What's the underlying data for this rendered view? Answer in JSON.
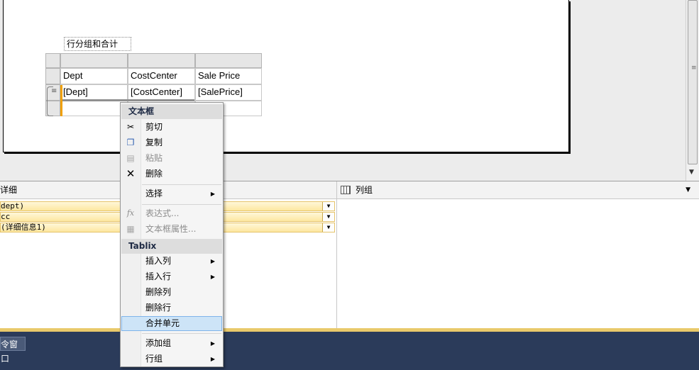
{
  "report": {
    "title_box": "行分组和合计",
    "tablix": {
      "headers": [
        "Dept",
        "CostCenter",
        "Sale Price"
      ],
      "fields": [
        "[Dept]",
        "[CostCenter]",
        "[SalePrice]"
      ]
    }
  },
  "grouping": {
    "row_groups_label": "详细",
    "row_groups": [
      {
        "label": "dept)"
      },
      {
        "label": "cc"
      },
      {
        "label": "(详细信息1)"
      }
    ],
    "column_groups_label": "列组"
  },
  "bottom_bar": {
    "command_window": "令窗口"
  },
  "context_menu": {
    "section_textbox": "文本框",
    "cut": "剪切",
    "copy": "复制",
    "paste": "粘贴",
    "delete": "删除",
    "select": "选择",
    "expression": "表达式...",
    "textbox_properties": "文本框属性...",
    "section_tablix": "Tablix",
    "insert_column": "插入列",
    "insert_row": "插入行",
    "delete_column": "删除列",
    "delete_row": "删除行",
    "merge_cells": "合并单元",
    "add_group": "添加组",
    "row_group": "行组"
  },
  "icons": {
    "cut": "scissors-icon",
    "copy": "copy-icon",
    "paste": "paste-icon",
    "delete": "x-icon",
    "expression": "fx-icon",
    "properties": "properties-icon"
  }
}
